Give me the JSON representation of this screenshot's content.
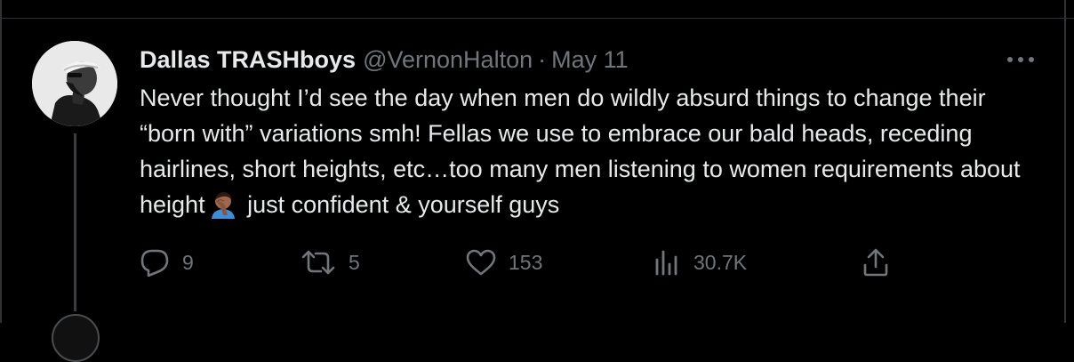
{
  "tweet": {
    "author_name": "Dallas TRASHboys",
    "author_handle": "@VernonHalton",
    "separator": "·",
    "date": "May 11",
    "text_before_emoji": "Never thought I’d see the day when men do wildly absurd things to change their “born with” variations smh! Fellas we use to embrace our bald heads, receding hairlines, short heights, etc…too many men listening to women requirements about height",
    "emoji": "face-palm-emoji",
    "text_after_emoji": "just confident & yourself guys"
  },
  "actions": {
    "reply_count": "9",
    "retweet_count": "5",
    "like_count": "153",
    "view_count": "30.7K"
  },
  "icons": {
    "reply": "reply-icon",
    "retweet": "retweet-icon",
    "like": "heart-icon",
    "views": "views-chart-icon",
    "share": "share-icon",
    "more": "more-dots-icon"
  },
  "colors": {
    "background": "#000000",
    "text_primary": "#e7e9ea",
    "text_secondary": "#71767b",
    "divider": "#2f3336"
  }
}
